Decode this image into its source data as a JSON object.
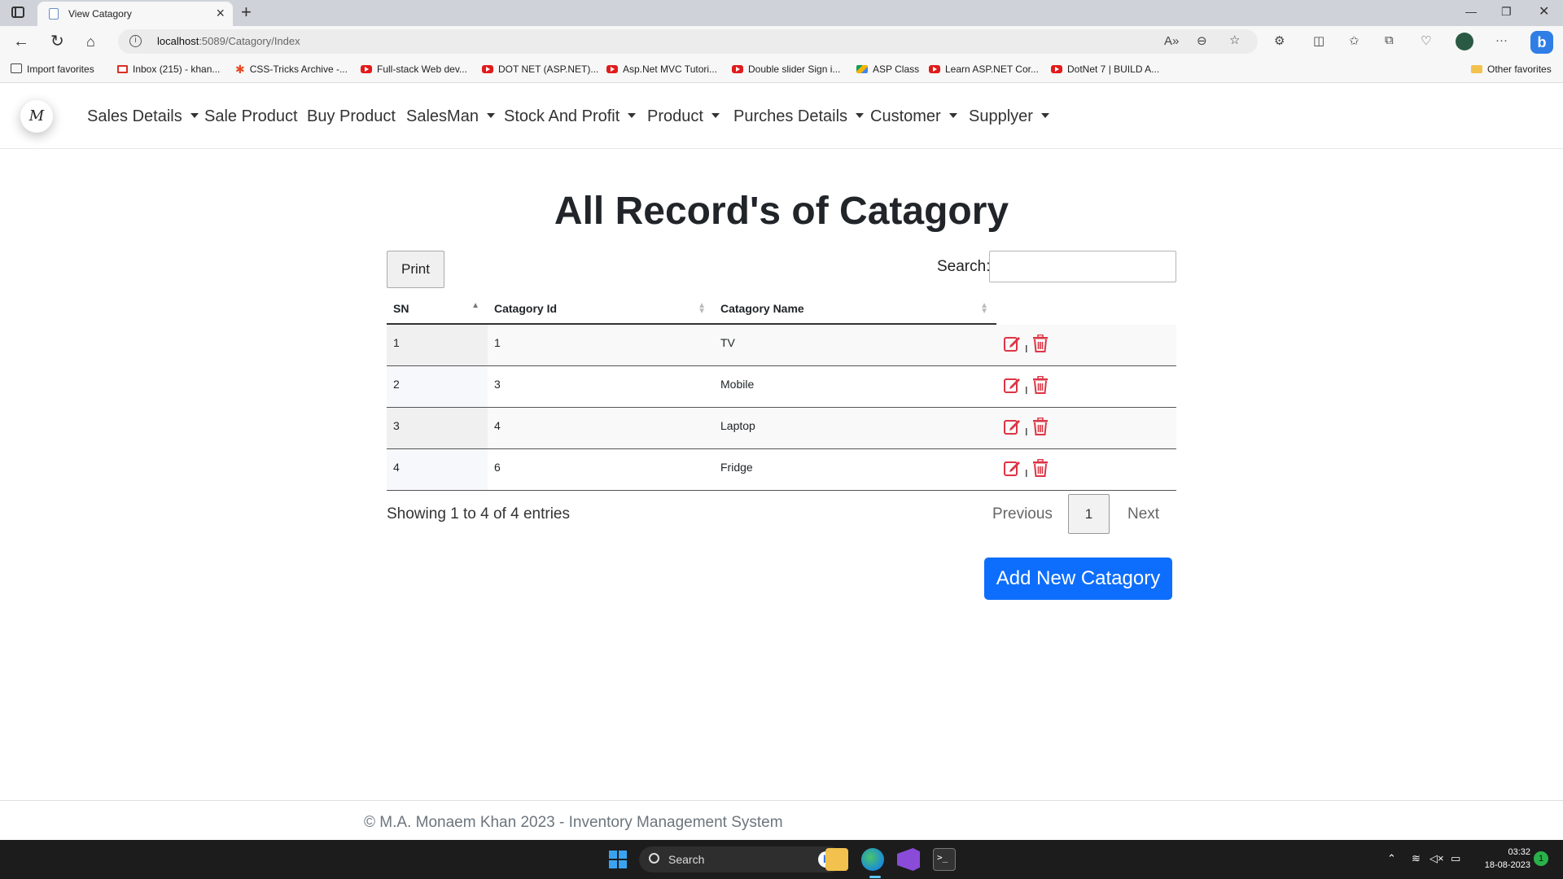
{
  "browser": {
    "tab_title": "View Catagory",
    "url_host": "localhost",
    "url_path": ":5089/Catagory/Index",
    "bookmarks": [
      "Import favorites",
      "Inbox (215) - khan...",
      "CSS-Tricks Archive -...",
      "Full-stack Web dev...",
      "DOT NET (ASP.NET)...",
      "Asp.Net MVC Tutori...",
      "Double slider Sign i...",
      "ASP Class",
      "Learn ASP.NET Cor...",
      "DotNet 7 | BUILD A...",
      "Other favorites"
    ]
  },
  "nav": {
    "brand": "M",
    "items": [
      {
        "label": "Sales Details",
        "dropdown": true
      },
      {
        "label": "Sale Product",
        "dropdown": false
      },
      {
        "label": "Buy Product",
        "dropdown": false
      },
      {
        "label": "SalesMan",
        "dropdown": true
      },
      {
        "label": "Stock And Profit",
        "dropdown": true
      },
      {
        "label": "Product",
        "dropdown": true
      },
      {
        "label": "Purches Details",
        "dropdown": true
      },
      {
        "label": "Customer",
        "dropdown": true
      },
      {
        "label": "Supplyer",
        "dropdown": true
      }
    ]
  },
  "page": {
    "title": "All Record's of Catagory",
    "print_label": "Print",
    "search_label": "Search:",
    "search_value": ""
  },
  "table": {
    "columns": [
      "SN",
      "Catagory Id",
      "Catagory Name",
      ""
    ],
    "rows": [
      {
        "sn": "1",
        "id": "1",
        "name": "TV"
      },
      {
        "sn": "2",
        "id": "3",
        "name": "Mobile"
      },
      {
        "sn": "3",
        "id": "4",
        "name": "Laptop"
      },
      {
        "sn": "4",
        "id": "6",
        "name": "Fridge"
      }
    ],
    "separator": "I",
    "info": "Showing 1 to 4 of 4 entries",
    "pagination": {
      "previous": "Previous",
      "current": "1",
      "next": "Next"
    }
  },
  "add_button_label": "Add New Catagory",
  "footer_text": "© M.A. Monaem Khan 2023 - Inventory Management System",
  "taskbar": {
    "search_placeholder": "Search",
    "time": "03:32",
    "date": "18-08-2023",
    "notification_count": "1"
  },
  "colors": {
    "primary": "#0d6efd",
    "action_icon": "#dc3545"
  }
}
